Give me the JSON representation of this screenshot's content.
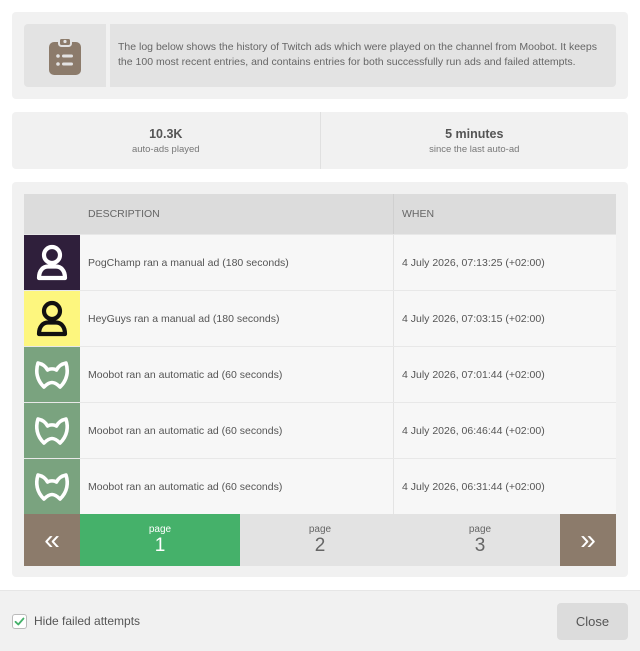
{
  "info": {
    "text": "The log below shows the history of Twitch ads which were played on the channel from Moobot. It keeps the 100 most recent entries, and contains entries for both successfully run ads and failed attempts.",
    "icon": "clipboard-list-icon"
  },
  "stats": [
    {
      "value": "10.3K",
      "label": "auto-ads played"
    },
    {
      "value": "5 minutes",
      "label": "since the last auto-ad"
    }
  ],
  "table": {
    "headers": {
      "description": "DESCRIPTION",
      "when": "WHEN"
    },
    "rows": [
      {
        "icon": "user-icon",
        "icon_bg": "#2f1f3b",
        "icon_fg": "#ffffff",
        "description": "PogChamp ran a manual ad (180 seconds)",
        "when": "4 July 2026, 07:13:25 (+02:00)"
      },
      {
        "icon": "user-icon",
        "icon_bg": "#fdf67e",
        "icon_fg": "#111111",
        "description": "HeyGuys ran a manual ad (180 seconds)",
        "when": "4 July 2026, 07:03:15 (+02:00)"
      },
      {
        "icon": "moobot-icon",
        "icon_bg": "#7aa37f",
        "icon_fg": "#ffffff",
        "description": "Moobot ran an automatic ad (60 seconds)",
        "when": "4 July 2026, 07:01:44 (+02:00)"
      },
      {
        "icon": "moobot-icon",
        "icon_bg": "#7aa37f",
        "icon_fg": "#ffffff",
        "description": "Moobot ran an automatic ad (60 seconds)",
        "when": "4 July 2026, 06:46:44 (+02:00)"
      },
      {
        "icon": "moobot-icon",
        "icon_bg": "#7aa37f",
        "icon_fg": "#ffffff",
        "description": "Moobot ran an automatic ad (60 seconds)",
        "when": "4 July 2026, 06:31:44 (+02:00)"
      }
    ]
  },
  "pagination": {
    "prev_label": "«",
    "next_label": "»",
    "page_word": "page",
    "pages": [
      "1",
      "2",
      "3"
    ],
    "active": "1"
  },
  "footer": {
    "checkbox_label": "Hide failed attempts",
    "checkbox_checked": true,
    "close_label": "Close"
  },
  "colors": {
    "accent_green": "#45b16a",
    "pager_arrow": "#8c7b6b",
    "clipboard_icon": "#8c7b6b",
    "moobot_bg": "#7aa37f"
  }
}
